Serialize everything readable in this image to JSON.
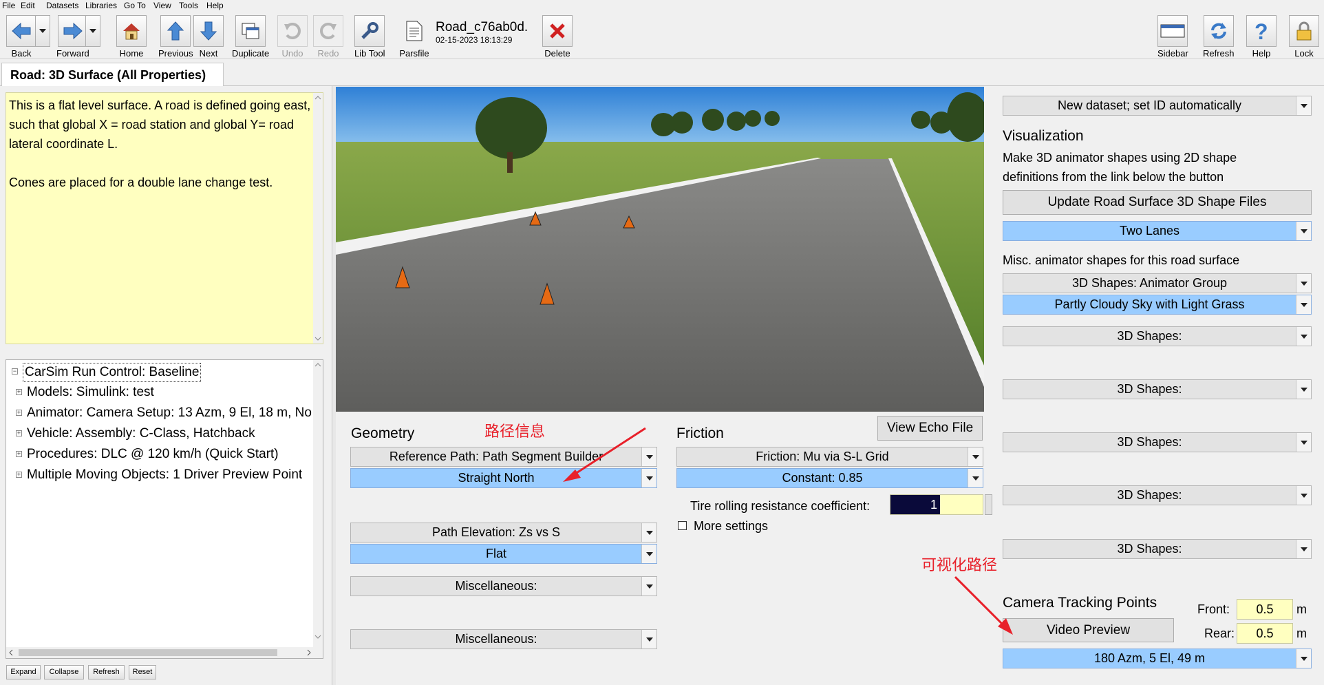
{
  "menu": [
    "File",
    "Edit",
    "Datasets",
    "Libraries",
    "Go To",
    "View",
    "Tools",
    "Help"
  ],
  "toolbar": {
    "back": "Back",
    "forward": "Forward",
    "home": "Home",
    "previous": "Previous",
    "next": "Next",
    "duplicate": "Duplicate",
    "undo": "Undo",
    "redo": "Redo",
    "lib_tool": "Lib Tool",
    "parsfile": "Parsfile",
    "delete": "Delete",
    "sidebar": "Sidebar",
    "refresh": "Refresh",
    "help": "Help",
    "lock": "Lock"
  },
  "dataset": {
    "title": "Road_c76ab0d.",
    "date": "02-15-2023 18:13:29"
  },
  "tab": {
    "title": "Road: 3D Surface (All Properties)"
  },
  "notes": {
    "para1": "This is a flat level surface. A road is defined going east, such that global X = road station and global Y= road lateral coordinate L.",
    "para2": "Cones are placed for a double lane change test."
  },
  "tree": {
    "root": "CarSim Run Control: Baseline",
    "items": [
      "Models: Simulink: test",
      "Animator: Camera Setup: 13 Azm, 9 El, 18 m, No",
      "Vehicle: Assembly: C-Class, Hatchback",
      "Procedures: DLC @ 120 km/h (Quick Start)",
      "Multiple Moving Objects: 1 Driver Preview Point"
    ]
  },
  "tree_buttons": [
    "Expand",
    "Collapse",
    "Refresh",
    "Reset"
  ],
  "geometry": {
    "title": "Geometry",
    "ref_path_category": "Reference Path: Path Segment Builder",
    "ref_path_value": "Straight North",
    "elevation_category": "Path Elevation: Zs vs S",
    "elevation_value": "Flat",
    "misc1": "Miscellaneous:",
    "misc2": "Miscellaneous:"
  },
  "friction": {
    "title": "Friction",
    "view_echo": "View Echo File",
    "category": "Friction: Mu via S-L Grid",
    "value": "Constant: 0.85",
    "tire_label": "Tire rolling resistance coefficient:",
    "tire_value": "1",
    "more_settings": "More settings"
  },
  "right": {
    "dataset_mode": "New dataset; set ID automatically",
    "vis_title": "Visualization",
    "vis_desc1": "Make 3D animator shapes using 2D shape",
    "vis_desc2": "definitions from the link below the button",
    "update_button": "Update Road Surface 3D Shape Files",
    "lanes": "Two Lanes",
    "misc_label": "Misc. animator shapes for this road surface",
    "animator_group": "3D Shapes: Animator Group",
    "sky": "Partly Cloudy Sky with Light Grass",
    "shapes": [
      "3D Shapes:",
      "3D Shapes:",
      "3D Shapes:",
      "3D Shapes:",
      "3D Shapes:"
    ],
    "camera_title": "Camera Tracking Points",
    "front_label": "Front:",
    "front_value": "0.5",
    "front_unit": "m",
    "rear_label": "Rear:",
    "rear_value": "0.5",
    "rear_unit": "m",
    "video_preview": "Video Preview",
    "camera_setup": "180 Azm, 5 El, 49 m"
  },
  "annotations": {
    "path_info": "路径信息",
    "visual_path": "可视化路径",
    "color": "#e8202a"
  }
}
